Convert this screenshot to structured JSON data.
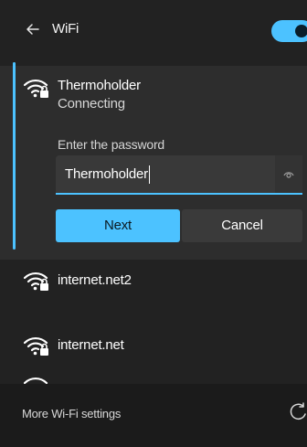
{
  "header": {
    "title": "WiFi",
    "back_icon": "back-arrow-icon",
    "toggle_on": true
  },
  "connecting_network": {
    "name": "Thermoholder",
    "status": "Connecting",
    "password_label": "Enter the password",
    "password_value": "Thermoholder",
    "next_label": "Next",
    "cancel_label": "Cancel",
    "icon": "wifi-lock-icon"
  },
  "networks": [
    {
      "name": "internet.net2",
      "icon": "wifi-lock-icon"
    },
    {
      "name": "internet.net",
      "icon": "wifi-lock-icon"
    }
  ],
  "footer": {
    "settings_label": "More Wi-Fi settings",
    "refresh_icon": "refresh-icon"
  },
  "colors": {
    "accent": "#4cc2ff",
    "background": "#222222",
    "expanded_background": "#2d2d2d"
  }
}
